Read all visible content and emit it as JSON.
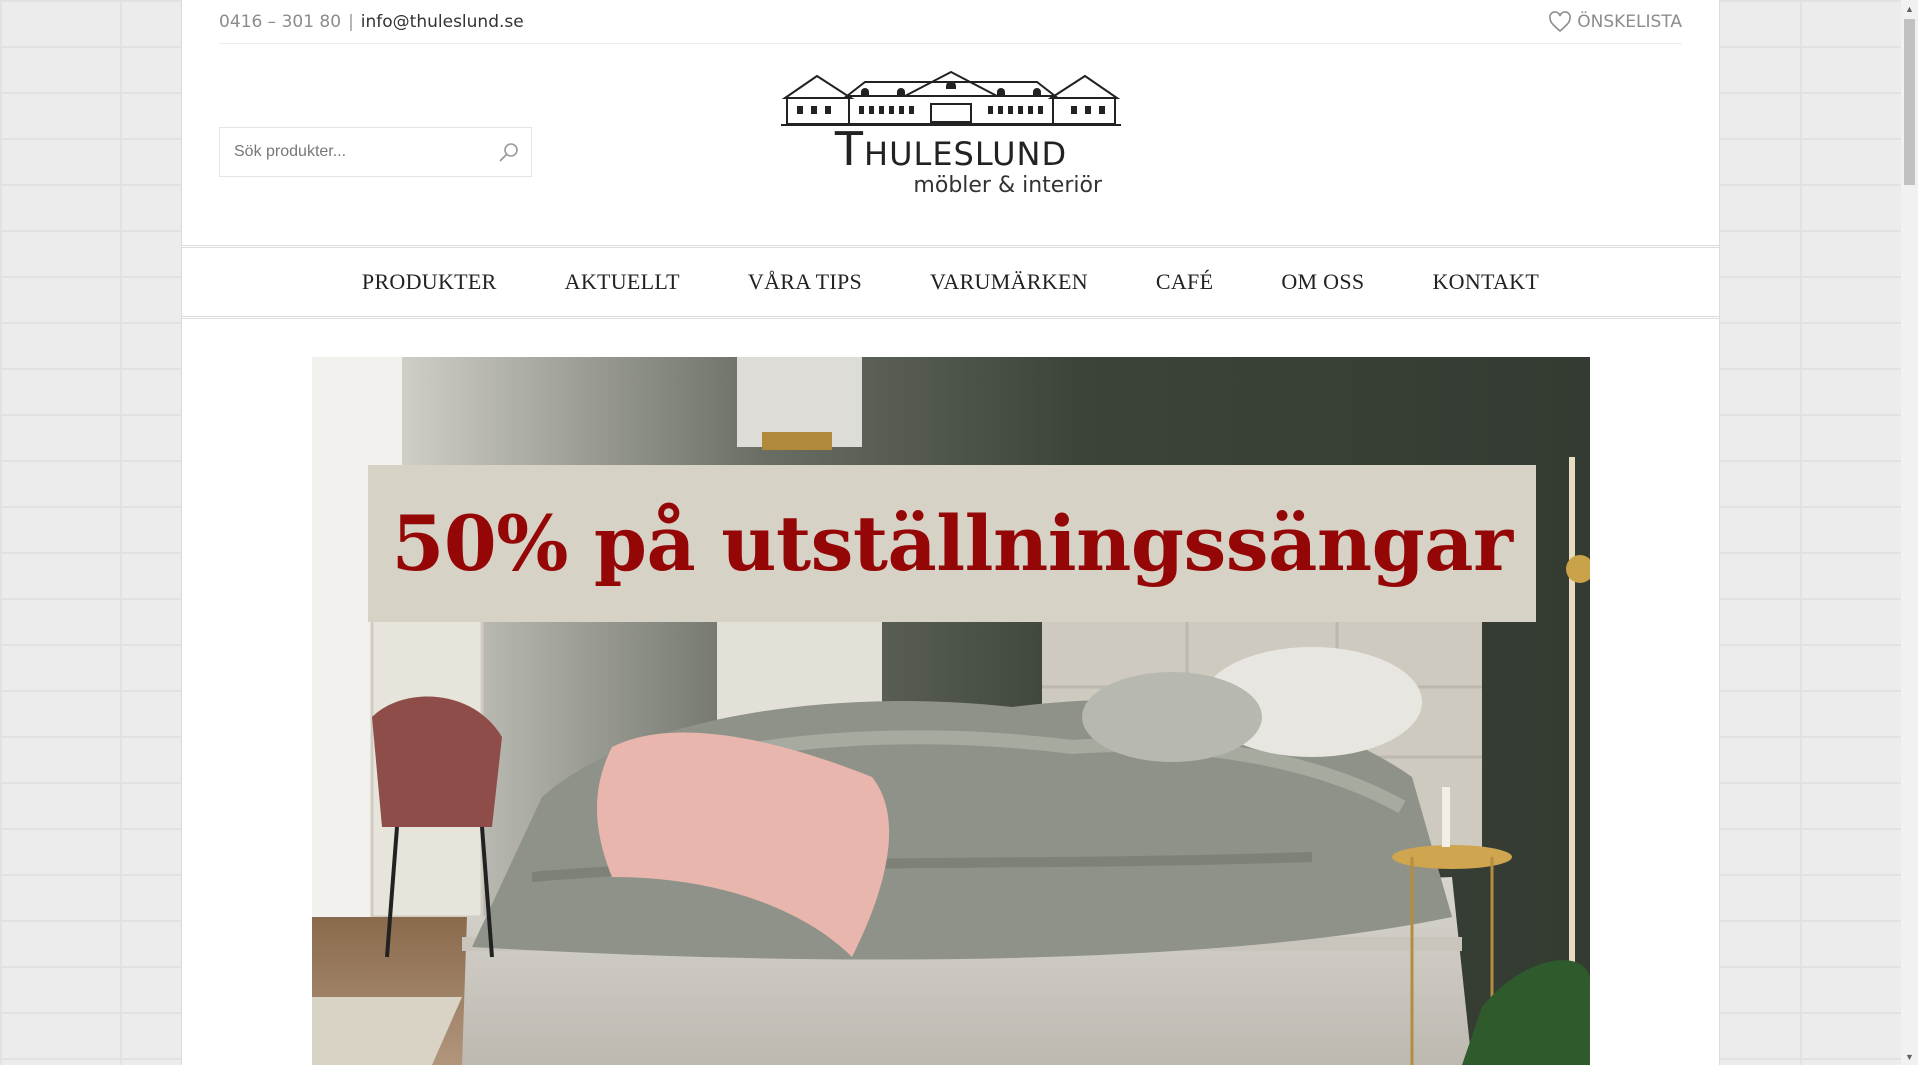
{
  "topbar": {
    "phone": "0416 – 301 80",
    "separator": "|",
    "email": "info@thuleslund.se",
    "wishlist_label": "ÖNSKELISTA",
    "wishlist_icon": "heart-icon"
  },
  "search": {
    "placeholder": "Sök produkter...",
    "icon": "search-icon"
  },
  "logo": {
    "name": "Thuleslund",
    "tagline": "möbler & interiör"
  },
  "nav": {
    "items": [
      {
        "label": "PRODUKTER"
      },
      {
        "label": "AKTUELLT"
      },
      {
        "label": "VÅRA TIPS"
      },
      {
        "label": "VARUMÄRKEN"
      },
      {
        "label": "CAFÉ"
      },
      {
        "label": "OM OSS"
      },
      {
        "label": "KONTAKT"
      }
    ]
  },
  "hero": {
    "banner_text": "50% på utställningssängar",
    "banner_color": "#950707"
  }
}
